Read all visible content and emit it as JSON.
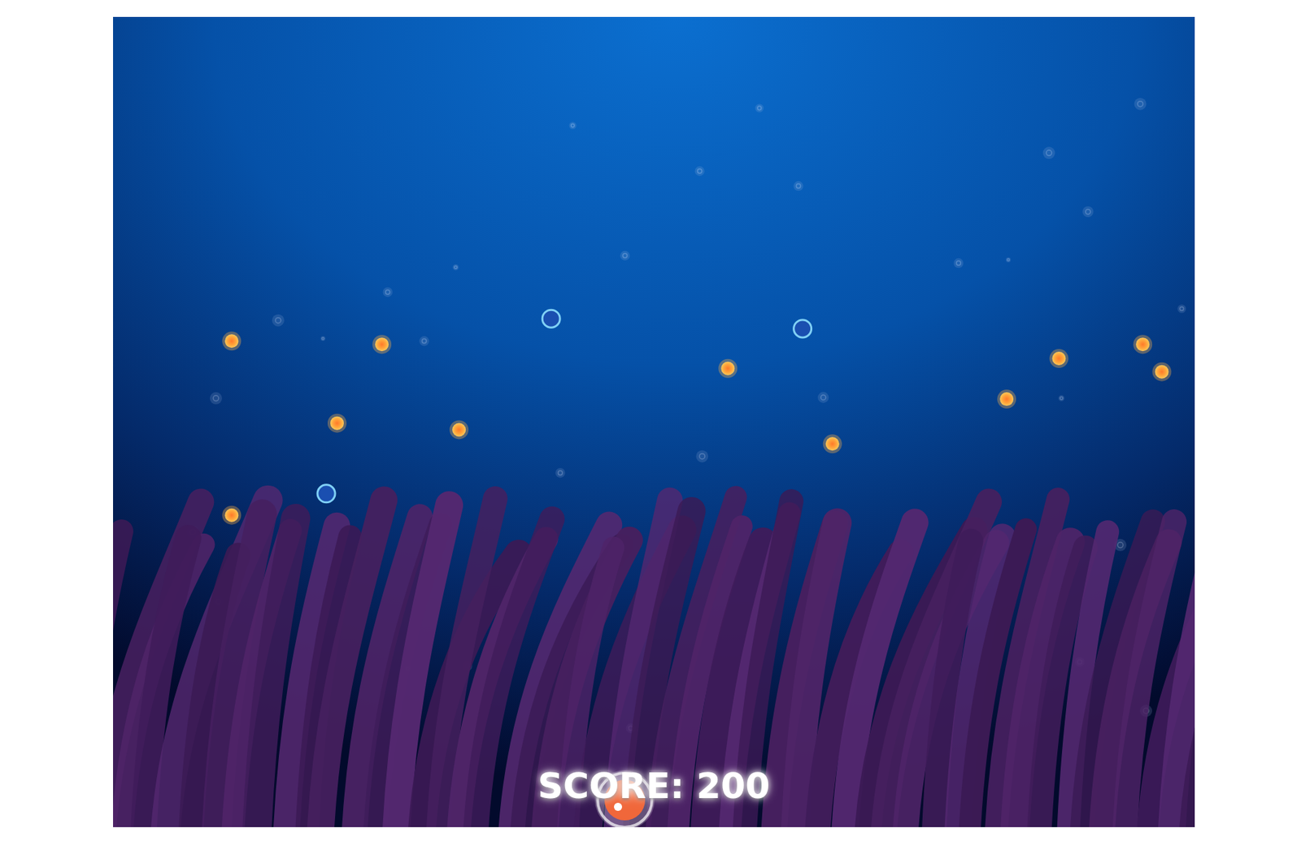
{
  "hud": {
    "score": "SCORE: 200"
  }
}
